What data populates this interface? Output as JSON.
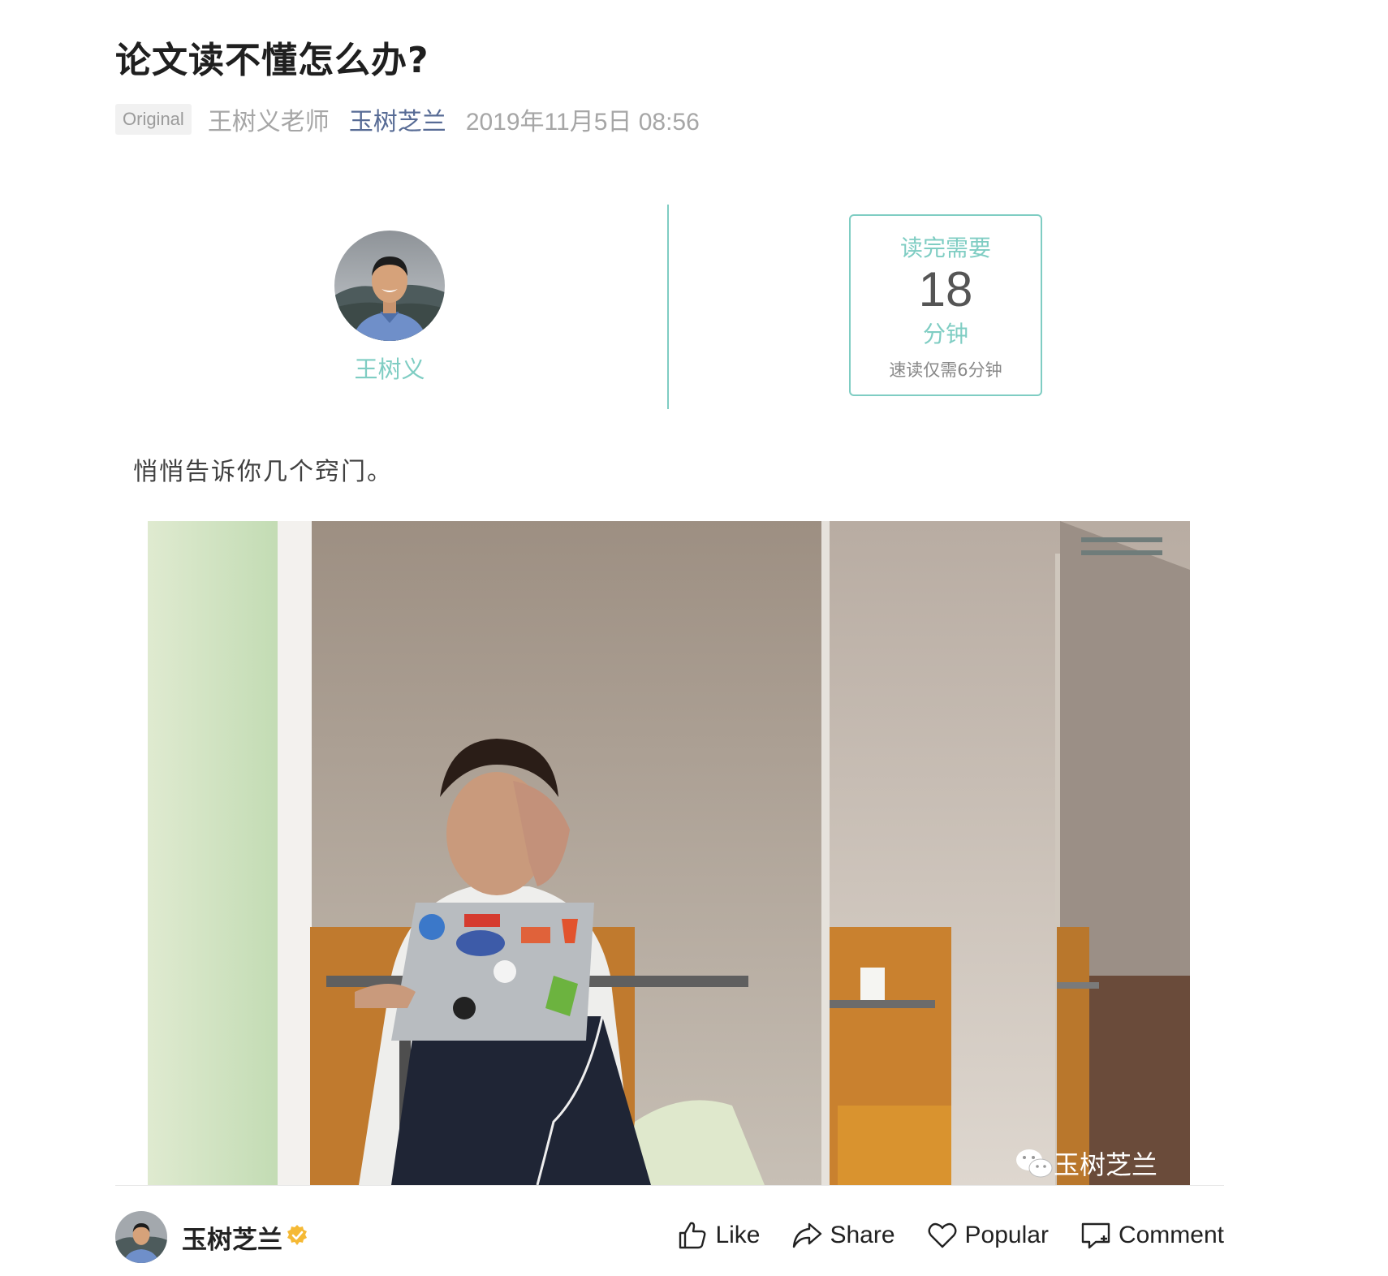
{
  "article": {
    "title": "论文读不懂怎么办?",
    "meta": {
      "tag": "Original",
      "author": "王树义老师",
      "account": "玉树芝兰",
      "date": "2019年11月5日 08:56"
    },
    "profile": {
      "name": "王树义"
    },
    "reading": {
      "label": "读完需要",
      "minutes": "18",
      "unit": "分钟",
      "fast": "速读仅需6分钟"
    },
    "intro": "悄悄告诉你几个窍门。",
    "image": {
      "watermark": "玉树芝兰"
    }
  },
  "bottom_bar": {
    "account_name": "玉树芝兰",
    "actions": [
      {
        "label": "Like",
        "icon": "thumbs-up-icon"
      },
      {
        "label": "Share",
        "icon": "share-arrow-icon"
      },
      {
        "label": "Popular",
        "icon": "heart-icon"
      },
      {
        "label": "Comment",
        "icon": "comment-icon"
      }
    ]
  },
  "colors": {
    "accent_teal": "#7fcdc3",
    "link_blue": "#576b95",
    "verified": "#f5b935"
  }
}
